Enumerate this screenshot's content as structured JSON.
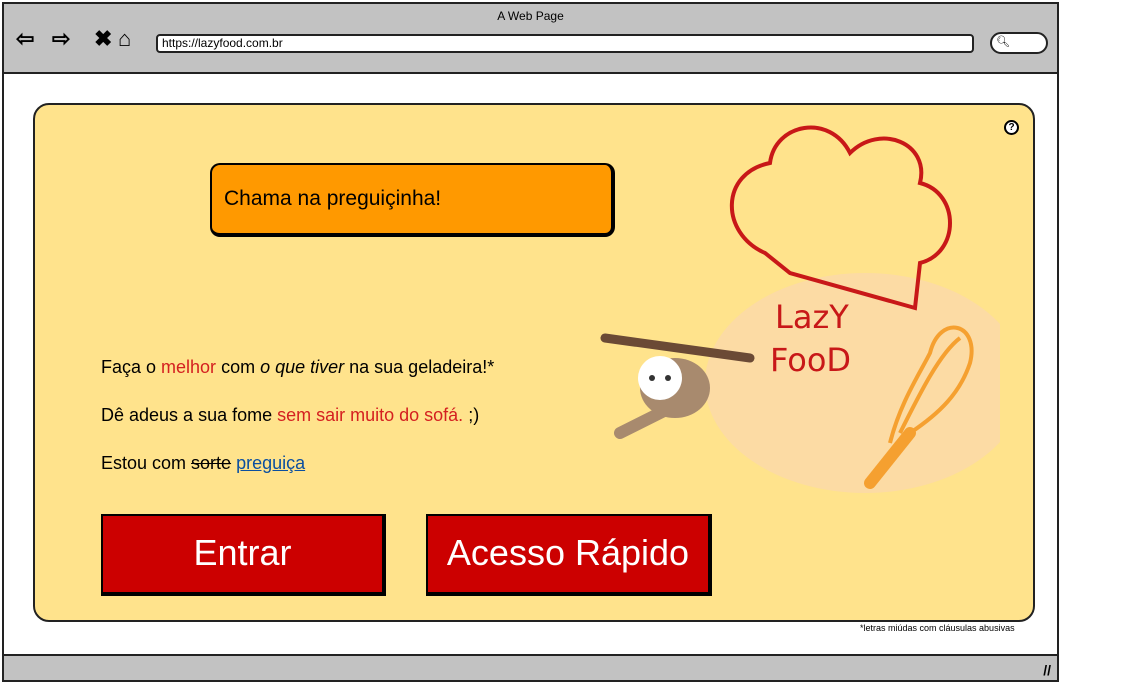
{
  "browser": {
    "title": "A Web Page",
    "url": "https://lazyfood.com.br"
  },
  "banner": {
    "text": "Chama na preguiçinha!"
  },
  "lines": {
    "l1": {
      "a": "Faça o ",
      "b": "melhor",
      "c": " com ",
      "d": "o que tiver",
      "e": " na sua geladeira!*"
    },
    "l2": {
      "a": "Dê adeus a sua fome ",
      "b": "sem sair muito do sofá.",
      "c": " ;)"
    },
    "l3": {
      "a": "Estou com ",
      "b": "sorte",
      "c": "preguiça"
    }
  },
  "buttons": {
    "login": "Entrar",
    "quick": "Acesso Rápido"
  },
  "logo": {
    "text1": "LazY",
    "text2": "FooD"
  },
  "footnote": "*letras miúdas com cláusulas abusivas",
  "help": "?",
  "colors": {
    "panel": "#ffe38c",
    "banner": "#ff9900",
    "button": "#cc0000",
    "accent": "#d42020"
  }
}
